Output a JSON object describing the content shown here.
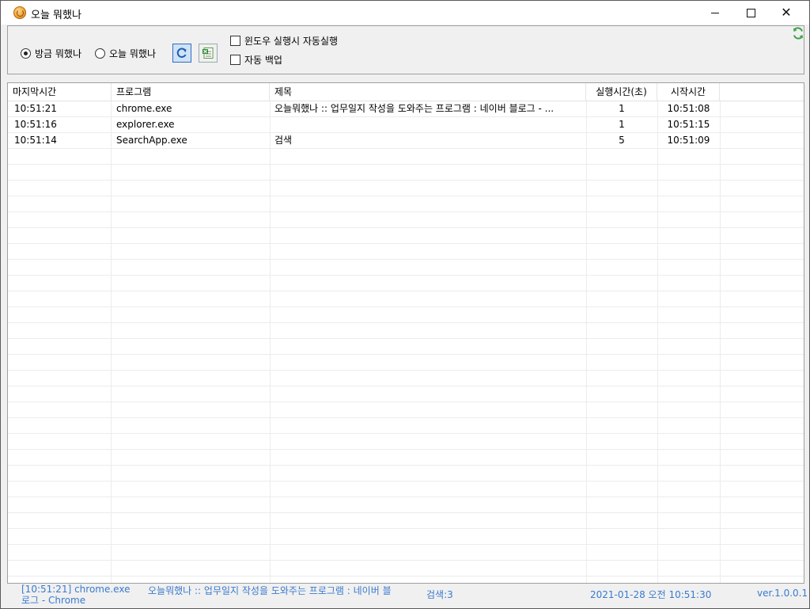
{
  "window": {
    "title": "오늘 뭐했나"
  },
  "options": {
    "radio_now": "방금 뭐했나",
    "radio_today": "오늘 뭐했나",
    "radio_selected": "now",
    "autorun_label": "윈도우 실행시 자동실행",
    "backup_label": "자동 백업"
  },
  "table": {
    "columns": [
      "마지막시간",
      "프로그램",
      "제목",
      "실행시간(초)",
      "시작시간"
    ],
    "rows": [
      {
        "last": "10:51:21",
        "program": "chrome.exe",
        "title": "오늘뭐했나 :: 업무일지 작성을 도와주는 프로그램 : 네이버 블로그 - ...",
        "duration": "1",
        "start": "10:51:08"
      },
      {
        "last": "10:51:16",
        "program": "explorer.exe",
        "title": "",
        "duration": "1",
        "start": "10:51:15"
      },
      {
        "last": "10:51:14",
        "program": "SearchApp.exe",
        "title": "검색",
        "duration": "5",
        "start": "10:51:09"
      }
    ]
  },
  "status": {
    "current_program": "[10:51:21] chrome.exe",
    "current_title_line1": "오늘뭐했나 :: 업무일지 작성을 도와주는 프로그램 : 네이버 블",
    "current_title_line2": "로그 - Chrome",
    "count": "검색:3",
    "datetime": "2021-01-28 오전 10:51:30",
    "version": "ver.1.0.0.1"
  },
  "colors": {
    "status_text": "#3a7ad0",
    "refresh_blue": "#2d6fc0",
    "sync_green": "#3aa346"
  }
}
